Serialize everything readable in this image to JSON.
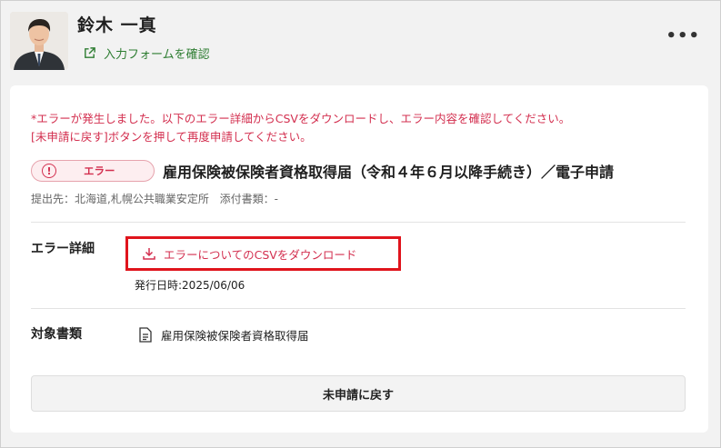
{
  "header": {
    "name": "鈴木 一真",
    "form_link_label": "入力フォームを確認",
    "more_label": "•••"
  },
  "error": {
    "line1": "*エラーが発生しました。以下のエラー詳細からCSVをダウンロードし、エラー内容を確認してください。",
    "line2": "[未申請に戻す]ボタンを押して再度申請してください。"
  },
  "status": {
    "badge_icon": "!",
    "badge_label": "エラー",
    "doc_title": "雇用保険被保険者資格取得届（令和４年６月以降手続き）／電子申請"
  },
  "meta": {
    "submit_to": "提出先：北海道,札幌公共職業安定所",
    "attachments": "添付書類：-"
  },
  "error_detail": {
    "label": "エラー詳細",
    "download_label": "エラーについてのCSVをダウンロード",
    "issue_date": "発行日時:2025/06/06"
  },
  "target": {
    "label": "対象書類",
    "document": "雇用保険被保険者資格取得届"
  },
  "actions": {
    "back_label": "未申請に戻す"
  },
  "colors": {
    "error": "#d32f4f",
    "highlight_border": "#e0141c",
    "link": "#2e7d32"
  }
}
